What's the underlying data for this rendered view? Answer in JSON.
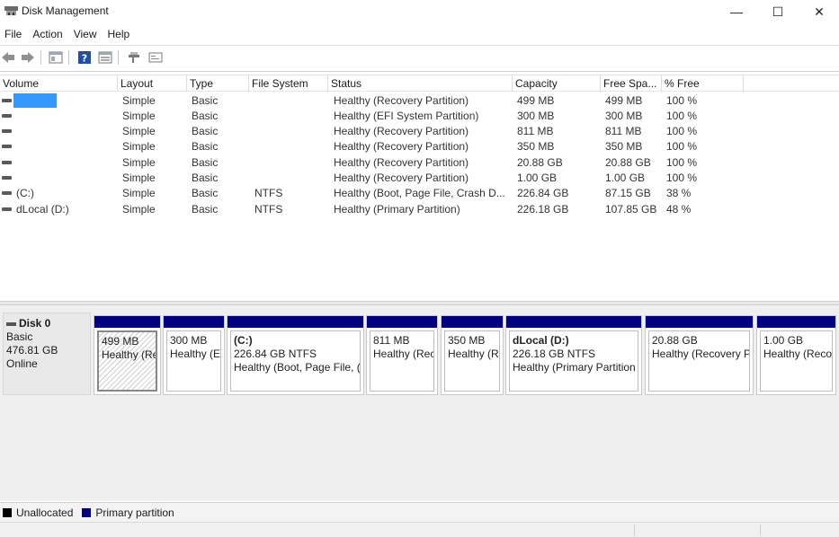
{
  "window": {
    "title": "Disk Management",
    "minimize_glyph": "—",
    "maximize_glyph": "☐",
    "close_glyph": "✕"
  },
  "menu": [
    "File",
    "Action",
    "View",
    "Help"
  ],
  "toolbar": {
    "icons": [
      "back-arrow-icon",
      "forward-arrow-icon",
      "properties-icon",
      "help-icon",
      "disk-list-icon",
      "connect-icon",
      "view-icon"
    ]
  },
  "volume_list": {
    "columns": [
      "Volume",
      "Layout",
      "Type",
      "File System",
      "Status",
      "Capacity",
      "Free Spa...",
      "% Free"
    ],
    "rows": [
      {
        "volume": "",
        "layout": "Simple",
        "type": "Basic",
        "fs": "",
        "status": "Healthy (Recovery Partition)",
        "capacity": "499 MB",
        "free": "499 MB",
        "pct": "100 %",
        "selected": true
      },
      {
        "volume": "",
        "layout": "Simple",
        "type": "Basic",
        "fs": "",
        "status": "Healthy (EFI System Partition)",
        "capacity": "300 MB",
        "free": "300 MB",
        "pct": "100 %"
      },
      {
        "volume": "",
        "layout": "Simple",
        "type": "Basic",
        "fs": "",
        "status": "Healthy (Recovery Partition)",
        "capacity": "811 MB",
        "free": "811 MB",
        "pct": "100 %"
      },
      {
        "volume": "",
        "layout": "Simple",
        "type": "Basic",
        "fs": "",
        "status": "Healthy (Recovery Partition)",
        "capacity": "350 MB",
        "free": "350 MB",
        "pct": "100 %"
      },
      {
        "volume": "",
        "layout": "Simple",
        "type": "Basic",
        "fs": "",
        "status": "Healthy (Recovery Partition)",
        "capacity": "20.88 GB",
        "free": "20.88 GB",
        "pct": "100 %"
      },
      {
        "volume": "",
        "layout": "Simple",
        "type": "Basic",
        "fs": "",
        "status": "Healthy (Recovery Partition)",
        "capacity": "1.00 GB",
        "free": "1.00 GB",
        "pct": "100 %"
      },
      {
        "volume": "(C:)",
        "layout": "Simple",
        "type": "Basic",
        "fs": "NTFS",
        "status": "Healthy (Boot, Page File, Crash D...",
        "capacity": "226.84 GB",
        "free": "87.15 GB",
        "pct": "38 %"
      },
      {
        "volume": "dLocal (D:)",
        "layout": "Simple",
        "type": "Basic",
        "fs": "NTFS",
        "status": "Healthy (Primary Partition)",
        "capacity": "226.18 GB",
        "free": "107.85 GB",
        "pct": "48 %"
      }
    ]
  },
  "disk": {
    "name": "Disk 0",
    "type": "Basic",
    "size": "476.81 GB",
    "state": "Online",
    "partitions": [
      {
        "name": "",
        "size": "499 MB",
        "status": "Healthy (Re",
        "hatched": true
      },
      {
        "name": "",
        "size": "300 MB",
        "status": "Healthy (E"
      },
      {
        "name": "(C:)",
        "size": "226.84 GB NTFS",
        "status": "Healthy (Boot, Page File, ("
      },
      {
        "name": "",
        "size": "811 MB",
        "status": "Healthy (Rec"
      },
      {
        "name": "",
        "size": "350 MB",
        "status": "Healthy (R"
      },
      {
        "name": "dLocal  (D:)",
        "size": "226.18 GB NTFS",
        "status": "Healthy (Primary Partition"
      },
      {
        "name": "",
        "size": "20.88 GB",
        "status": "Healthy (Recovery P"
      },
      {
        "name": "",
        "size": "1.00 GB",
        "status": "Healthy (Reco"
      }
    ]
  },
  "legend": [
    {
      "label": "Unallocated",
      "color": "#000000"
    },
    {
      "label": "Primary partition",
      "color": "#000080"
    }
  ],
  "colors": {
    "primary_partition": "#000080",
    "selection": "#3399ff"
  }
}
